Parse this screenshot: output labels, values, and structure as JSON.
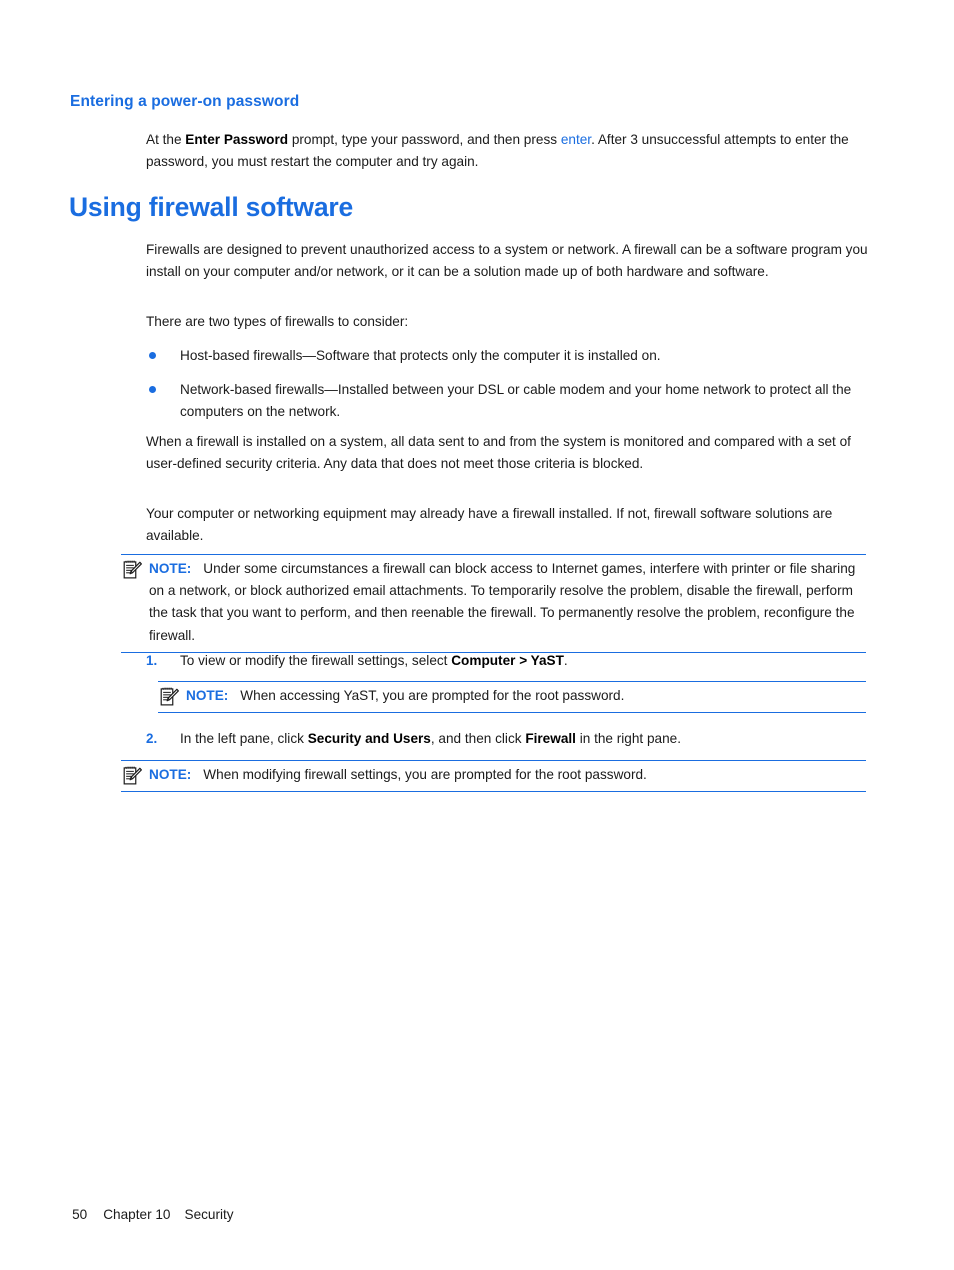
{
  "document": {
    "heading_color": "#1a6de0",
    "text_color": "#1b1b1b"
  },
  "sections": {
    "subheading": "Entering a power-on password",
    "power_on_paragraph": {
      "part1": "At the ",
      "bold1": "Enter Password",
      "part2": " prompt, type your password, and then press ",
      "link": "enter",
      "part3": ". After 3 unsuccessful attempts to enter the password, you must restart the computer and try again."
    },
    "main_heading": "Using firewall software",
    "intro_paragraph": "Firewalls are designed to prevent unauthorized access to a system or network. A firewall can be a software program you install on your computer and/or network, or it can be a solution made up of both hardware and software.",
    "types_lead": "There are two types of firewalls to consider:",
    "bullets": [
      "Host-based firewalls—Software that protects only the computer it is installed on.",
      "Network-based firewalls—Installed between your DSL or cable modem and your home network to protect all the computers on the network."
    ],
    "monitored_paragraph": "When a firewall is installed on a system, all data sent to and from the system is monitored and compared with a set of user-defined security criteria. Any data that does not meet those criteria is blocked.",
    "already_paragraph": "Your computer or networking equipment may already have a firewall installed. If not, firewall software solutions are available."
  },
  "notes": [
    {
      "label": "NOTE:",
      "icon": "note-pencil-icon",
      "text": "Under some circumstances a firewall can block access to Internet games, interfere with printer or file sharing on a network, or block authorized email attachments. To temporarily resolve the problem, disable the firewall, perform the task that you want to perform, and then reenable the firewall. To permanently resolve the problem, reconfigure the firewall."
    },
    {
      "label": "NOTE:",
      "icon": "note-pencil-icon",
      "text": "When accessing YaST, you are prompted for the root password."
    },
    {
      "label": "NOTE:",
      "icon": "note-pencil-icon",
      "text": "When modifying firewall settings, you are prompted for the root password."
    }
  ],
  "steps": [
    {
      "number": "1.",
      "part1": "To view or modify the firewall settings, select ",
      "bold1": "Computer > YaST",
      "part2": "."
    },
    {
      "number": "2.",
      "part1": "In the left pane, click ",
      "bold1": "Security and Users",
      "part2": ", and then click ",
      "bold2": "Firewall",
      "part3": " in the right pane."
    }
  ],
  "footer": {
    "page_number": "50",
    "chapter": "Chapter 10",
    "chapter_title": "Security"
  }
}
